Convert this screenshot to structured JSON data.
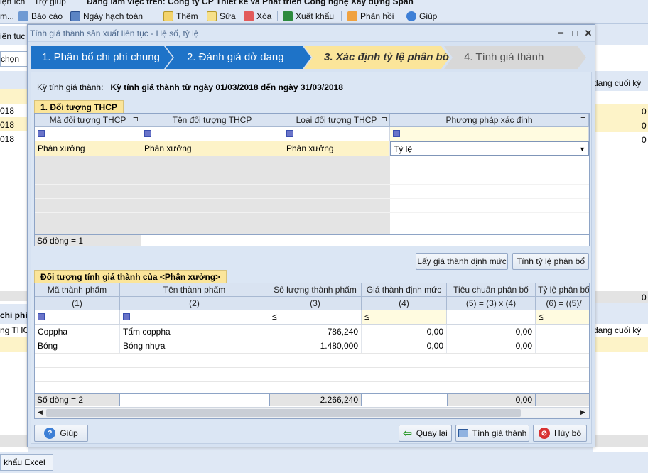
{
  "app": {
    "menu": [
      "iện ích",
      "Trợ giúp",
      "Đang làm việc trên: Công ty CP Thiết kế và Phát triển Công nghệ Xây dựng Span"
    ],
    "toolbar": {
      "cut_label": "m...",
      "report_label": "Báo cáo",
      "accounting_date_label": "Ngày hạch toán",
      "add_label": "Thêm",
      "edit_label": "Sửa",
      "delete_label": "Xóa",
      "export_label": "Xuất khẩu",
      "feedback_label": "Phản hồi",
      "help_label": "Giúp"
    },
    "background": {
      "left_title": "iên tục -",
      "left_select": "chọn",
      "left_dates": [
        "018",
        "018",
        "018"
      ],
      "left_section": "chi phí",
      "left_col": "ng THCP",
      "right_col_1": "dang cuối kỳ",
      "right_vals": [
        "0",
        "0",
        "0"
      ],
      "right_mid_val": "0",
      "right_col_2": "dang cuối kỳ",
      "excel_label": "khẩu Excel"
    }
  },
  "dialog": {
    "title": "Tính giá thành sản xuất liên tục - Hệ số, tỷ lệ",
    "steps": [
      {
        "label": "1. Phân bổ chi phí chung",
        "state": "done"
      },
      {
        "label": "2. Đánh giá dở dang",
        "state": "done"
      },
      {
        "label": "3. Xác định tỷ lệ phân bổ",
        "state": "active"
      },
      {
        "label": "4. Tính giá thành",
        "state": "pending"
      }
    ],
    "period_label": "Kỳ tính giá thành:",
    "period_value": "Kỳ tính giá thành từ ngày 01/03/2018 đến ngày 31/03/2018",
    "section1": {
      "tab": "1. Đối tượng THCP",
      "columns": [
        "Mã đối tượng THCP",
        "Tên đối tượng THCP",
        "Loại đối tượng THCP",
        "Phương pháp xác định"
      ],
      "rows": [
        {
          "code": "Phân xưởng",
          "name": "Phân xưởng",
          "type": "Phân xưởng",
          "method": "Tỷ lệ"
        }
      ],
      "footer": "Số dòng = 1"
    },
    "buttons_mid": {
      "get_standard_cost": "Lấy giá thành định mức",
      "calc_ratio": "Tính tỷ lệ phân bổ"
    },
    "section2": {
      "tab": "Đối tượng tính giá thành của <Phân xưởng>",
      "columns": [
        "Mã thành phẩm",
        "Tên thành phẩm",
        "Số lượng thành phẩm",
        "Giá thành định mức",
        "Tiêu chuẩn phân bổ",
        "Tỷ lệ phân bổ"
      ],
      "subheaders": [
        "(1)",
        "(2)",
        "(3)",
        "(4)",
        "(5) = (3) x (4)",
        "(6) = ((5)/"
      ],
      "filter_ops": [
        "≤",
        "≤",
        "≤"
      ],
      "rows": [
        {
          "code": "Coppha",
          "name": "Tấm coppha",
          "qty": "786,240",
          "std_cost": "0,00",
          "criteria": "0,00",
          "ratio": ""
        },
        {
          "code": "Bóng",
          "name": "Bóng nhựa",
          "qty": "1.480,000",
          "std_cost": "0,00",
          "criteria": "0,00",
          "ratio": ""
        }
      ],
      "footer": "Số dòng = 2",
      "footer_qty": "2.266,240",
      "footer_criteria": "0,00"
    },
    "bottom_buttons": {
      "help": "Giúp",
      "back": "Quay lại",
      "calc_cost": "Tính giá thành",
      "cancel": "Hủy bỏ"
    }
  }
}
